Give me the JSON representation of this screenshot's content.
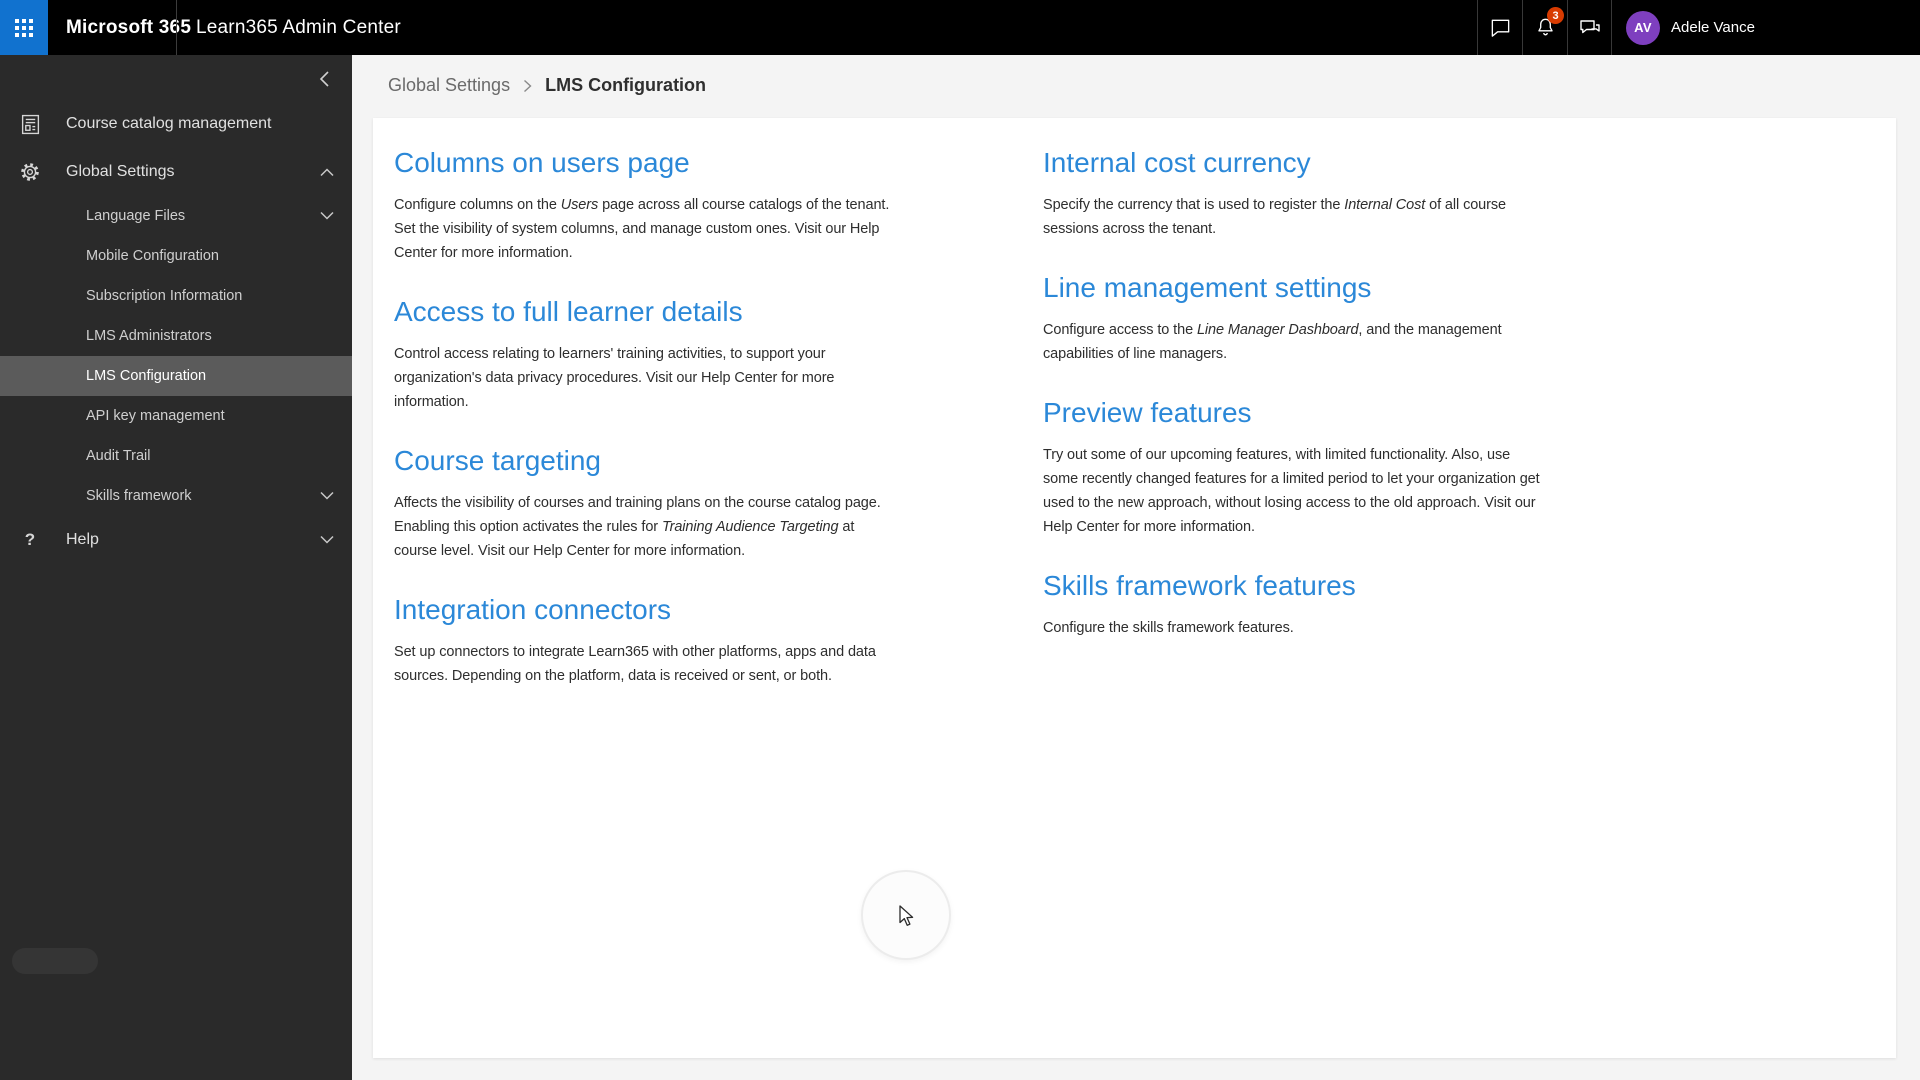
{
  "topbar": {
    "brand": "Microsoft 365",
    "app_title": "Learn365 Admin Center",
    "notifications_badge": "3",
    "user_initials": "AV",
    "user_name": "Adele Vance",
    "icons": [
      "app-launcher-icon",
      "chat-icon",
      "bell-icon",
      "feedback-icon"
    ]
  },
  "sidebar": {
    "collapse_icon": "chevron-left-icon",
    "items": [
      {
        "label": "Course catalog management",
        "icon": "catalog-icon",
        "level": 0
      },
      {
        "label": "Global Settings",
        "icon": "gear-icon",
        "level": 0,
        "chevron": "up",
        "expanded": true
      },
      {
        "label": "Language Files",
        "level": 1,
        "chevron": "down"
      },
      {
        "label": "Mobile Configuration",
        "level": 1
      },
      {
        "label": "Subscription Information",
        "level": 1
      },
      {
        "label": "LMS Administrators",
        "level": 1
      },
      {
        "label": "LMS Configuration",
        "level": 1,
        "selected": true
      },
      {
        "label": "API key management",
        "level": 1
      },
      {
        "label": "Audit Trail",
        "level": 1
      },
      {
        "label": "Skills framework",
        "level": 1,
        "chevron": "down"
      },
      {
        "label": "Help",
        "icon": "help-icon",
        "level": 0,
        "chevron": "down"
      }
    ]
  },
  "breadcrumb": {
    "parent": "Global Settings",
    "separator": ">",
    "current": "LMS Configuration"
  },
  "sections": {
    "left": [
      {
        "title": "Columns on users page",
        "body": [
          {
            "t": "Configure columns on the "
          },
          {
            "t": "Users",
            "i": true
          },
          {
            "t": " page across all course catalogs of the tenant. Set the visibility of system columns, and manage custom ones. Visit our Help Center for more information."
          }
        ]
      },
      {
        "title": "Access to full learner details",
        "body": [
          {
            "t": "Control access relating to learners' training activities, to support your organization's data privacy procedures. Visit our Help Center for more information."
          }
        ]
      },
      {
        "title": "Course targeting",
        "body": [
          {
            "t": "Affects the visibility of courses and training plans on the course catalog page. Enabling this option activates the rules for "
          },
          {
            "t": "Training Audience Targeting",
            "i": true
          },
          {
            "t": " at course level. Visit our Help Center for more information."
          }
        ]
      },
      {
        "title": "Integration connectors",
        "body": [
          {
            "t": "Set up connectors to integrate Learn365 with other platforms, apps and data sources. Depending on the platform, data is received or sent, or both."
          }
        ]
      }
    ],
    "right": [
      {
        "title": "Internal cost currency",
        "body": [
          {
            "t": "Specify the currency that is used to register the "
          },
          {
            "t": "Internal Cost",
            "i": true
          },
          {
            "t": " of all course sessions across the tenant."
          }
        ]
      },
      {
        "title": "Line management settings",
        "body": [
          {
            "t": "Configure access to the "
          },
          {
            "t": "Line Manager Dashboard",
            "i": true
          },
          {
            "t": ", and the management capabilities of line managers."
          }
        ]
      },
      {
        "title": "Preview features",
        "body": [
          {
            "t": "Try out some of our upcoming features, with limited functionality. Also, use some recently changed features for a limited period to let your organization get used to the new approach, without losing access to the old approach. Visit our Help Center for more information."
          }
        ]
      },
      {
        "title": "Skills framework features",
        "body": [
          {
            "t": "Configure the skills framework features."
          }
        ]
      }
    ]
  },
  "colors": {
    "topbar_bg": "#000000",
    "waffle_blue": "#1172cf",
    "badge_orange": "#d83b01",
    "avatar_purple": "#7e3fbf",
    "sidebar_bg": "#2a2a2a",
    "sidebar_selected_bg": "#5b5b5b",
    "heading_blue": "#2b88d8",
    "content_bg": "#f4f4f4"
  }
}
